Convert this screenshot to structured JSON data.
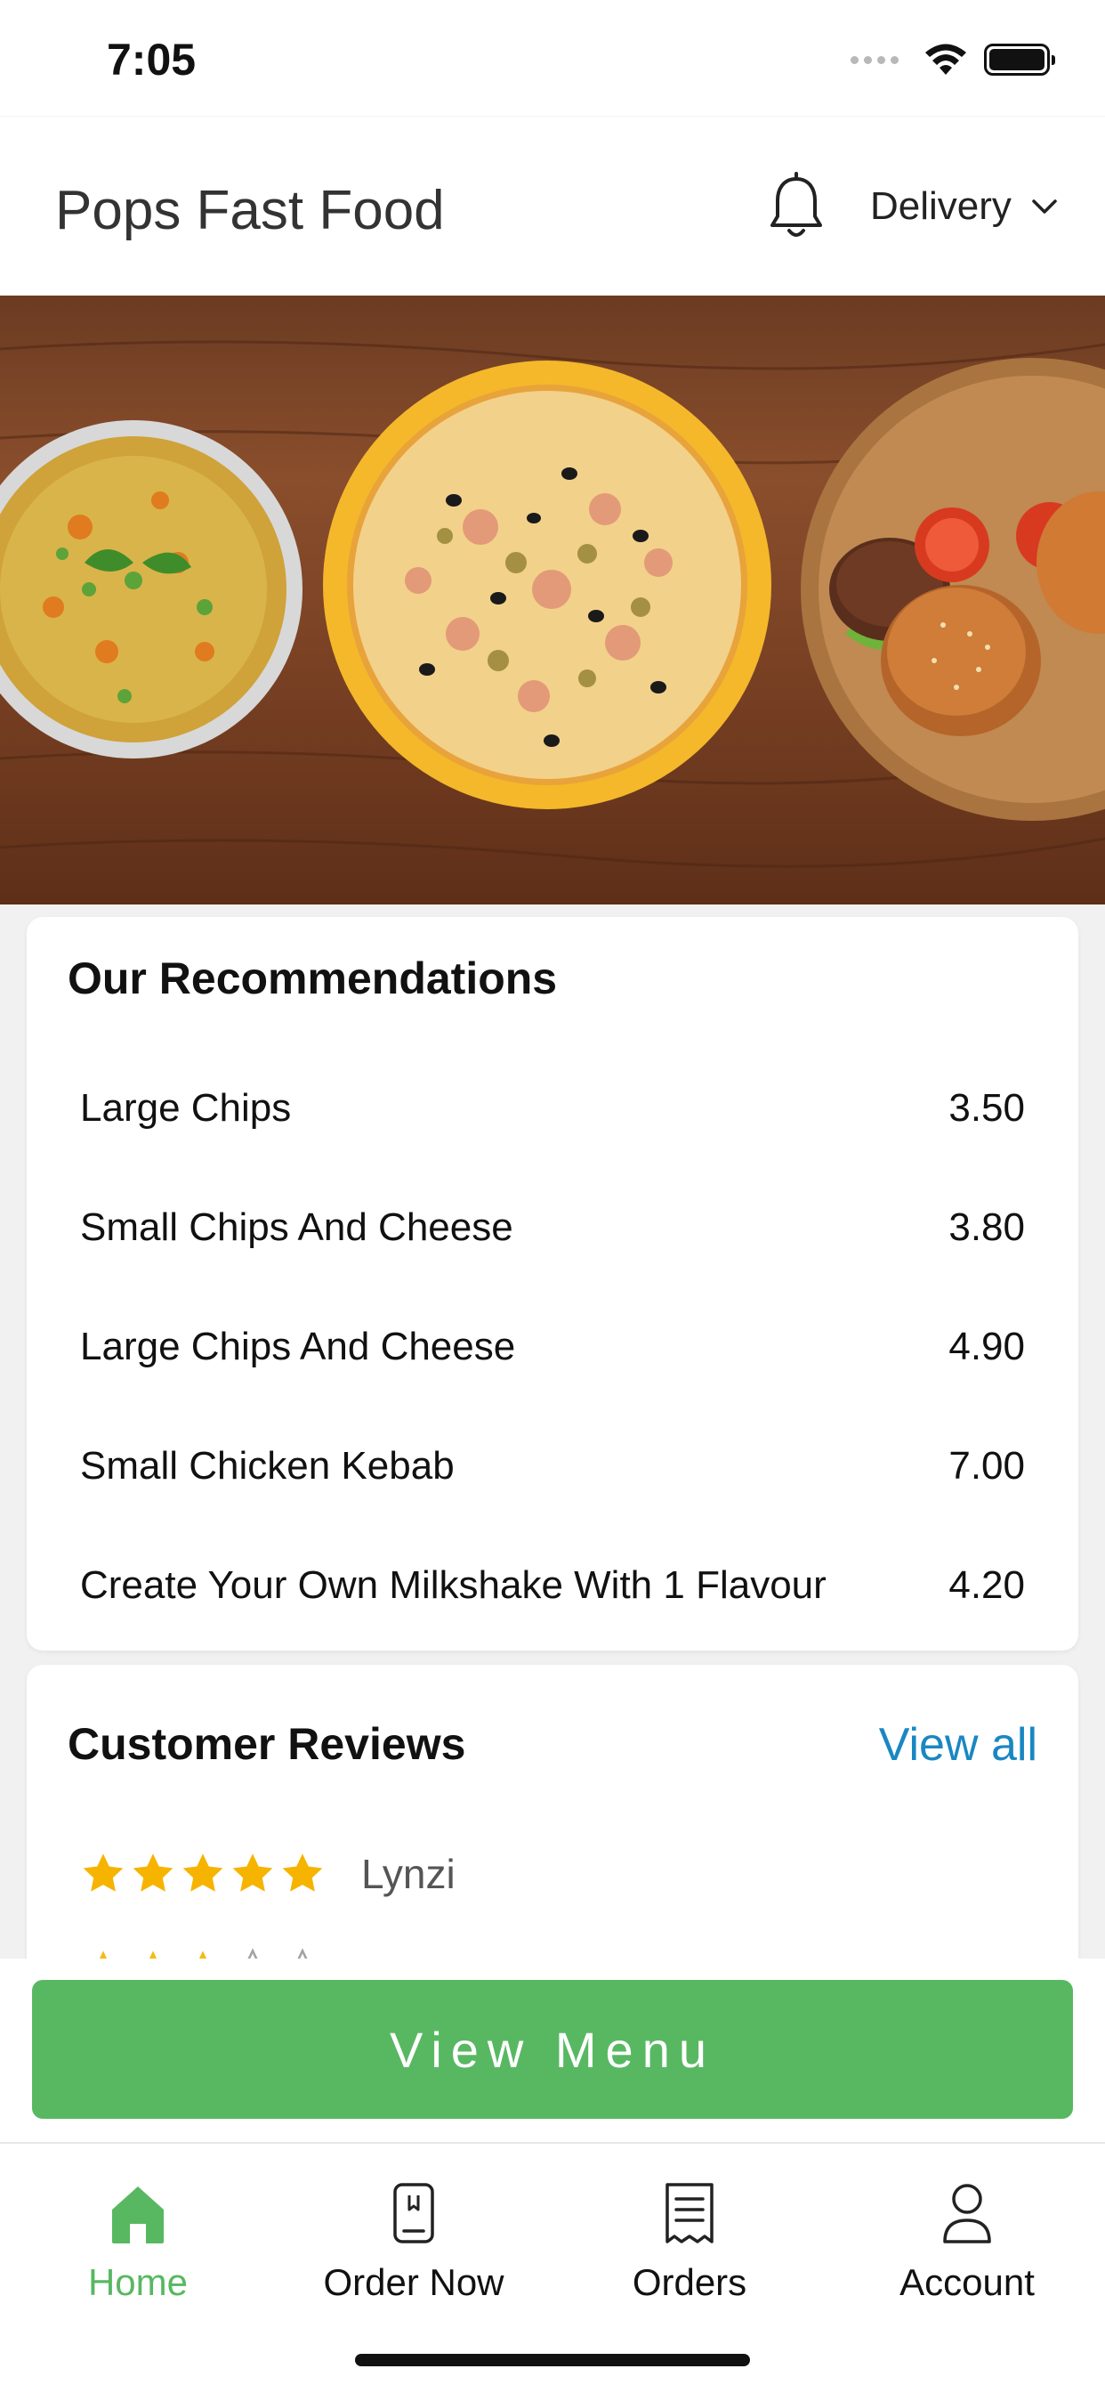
{
  "status_bar": {
    "time": "7:05"
  },
  "header": {
    "title": "Pops Fast Food",
    "delivery_label": "Delivery"
  },
  "recommendations": {
    "title": "Our Recommendations",
    "items": [
      {
        "name": "Large Chips",
        "price": "3.50"
      },
      {
        "name": "Small Chips And Cheese",
        "price": "3.80"
      },
      {
        "name": "Large Chips And Cheese",
        "price": "4.90"
      },
      {
        "name": "Small Chicken Kebab",
        "price": "7.00"
      },
      {
        "name": "Create Your Own Milkshake With 1 Flavour",
        "price": "4.20"
      }
    ]
  },
  "reviews": {
    "title": "Customer Reviews",
    "view_all": "View all",
    "items": [
      {
        "reviewer": "Lynzi",
        "rating": 5
      }
    ]
  },
  "cta": {
    "view_menu": "View Menu"
  },
  "tabs": [
    {
      "label": "Home",
      "icon": "home-icon",
      "active": true
    },
    {
      "label": "Order Now",
      "icon": "phone-icon",
      "active": false
    },
    {
      "label": "Orders",
      "icon": "receipt-icon",
      "active": false
    },
    {
      "label": "Account",
      "icon": "user-icon",
      "active": false
    }
  ],
  "colors": {
    "accent_green": "#58b862",
    "link_blue": "#1a87c2",
    "star_gold": "#f6b400"
  }
}
